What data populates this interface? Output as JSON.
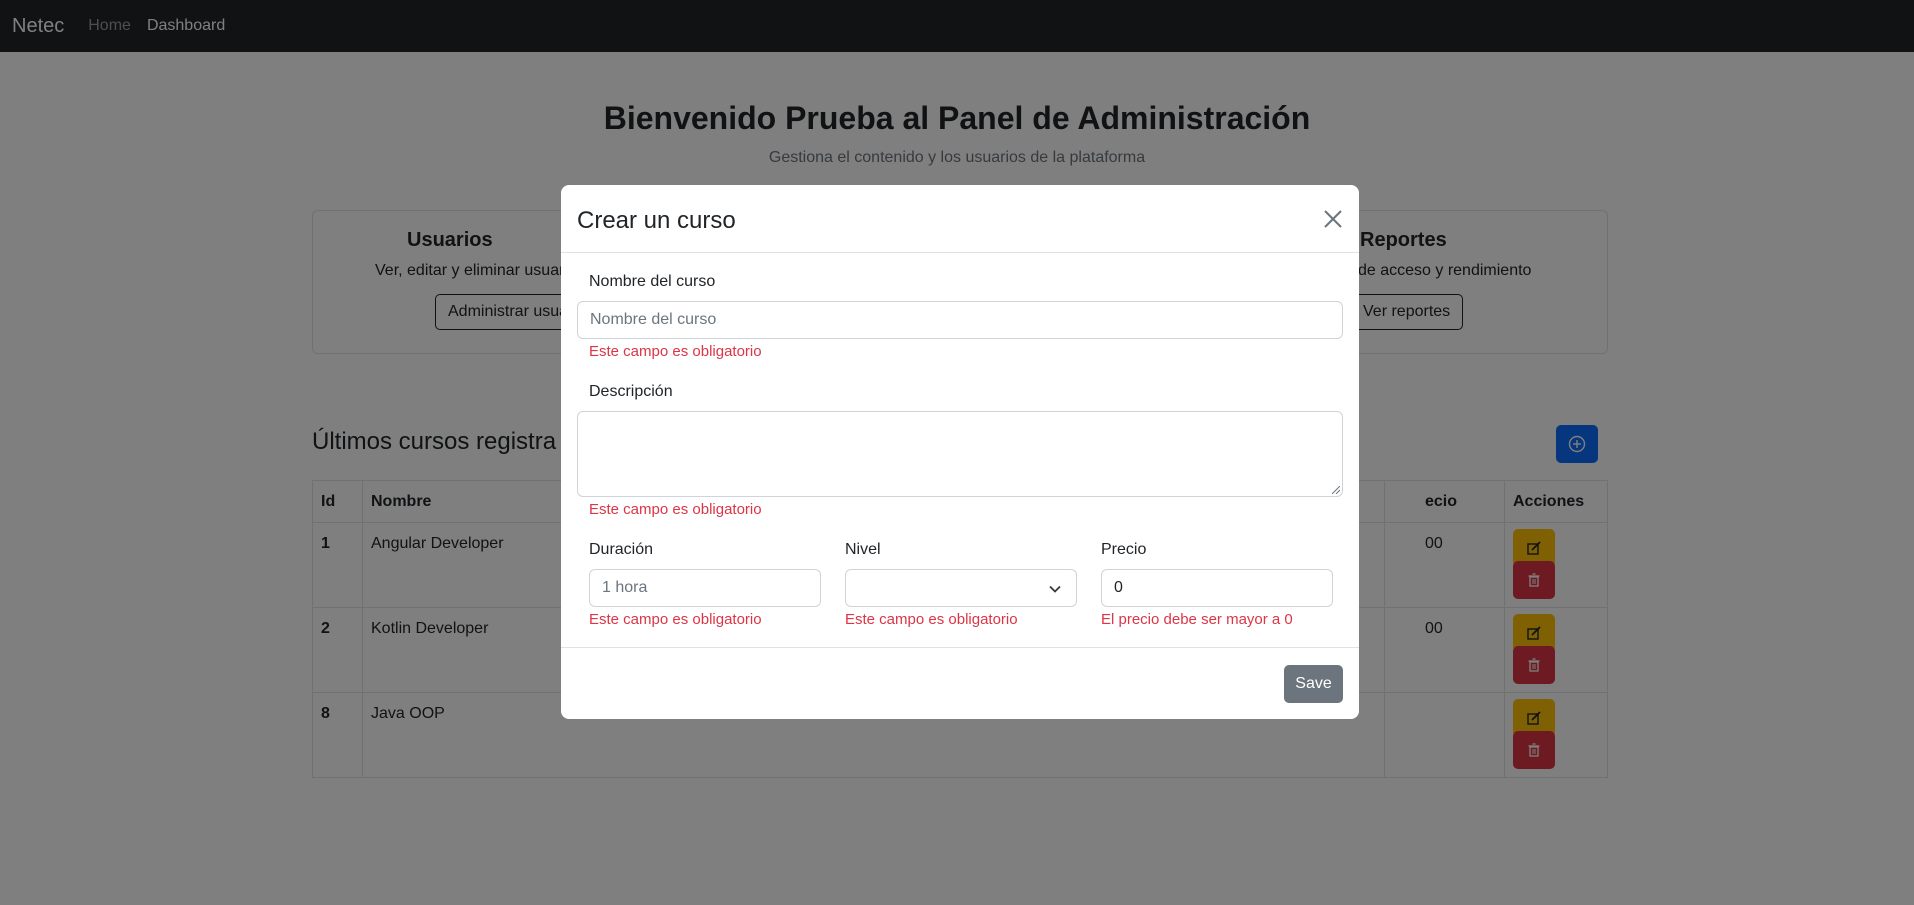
{
  "navbar": {
    "brand": "Netec",
    "links": [
      "Home",
      "Dashboard"
    ]
  },
  "page": {
    "title": "Bienvenido Prueba al Panel de Administración",
    "subtitle": "Gestiona el contenido y los usuarios de la plataforma"
  },
  "cards": [
    {
      "title": "Usuarios",
      "text": "Ver, editar y eliminar usuar",
      "button": "Administrar usua"
    },
    {
      "title": "Reportes",
      "text": "de acceso y rendimiento",
      "button": "Ver reportes"
    }
  ],
  "courses": {
    "title": "Últimos cursos registra",
    "headers": [
      "Id",
      "Nombre",
      "ecio",
      "Acciones"
    ],
    "rows": [
      {
        "id": "1",
        "name": "Angular Developer",
        "price": "00"
      },
      {
        "id": "2",
        "name": "Kotlin Developer",
        "price": "00"
      },
      {
        "id": "8",
        "name": "Java OOP",
        "price": ""
      }
    ]
  },
  "modal": {
    "title": "Crear un curso",
    "nombre": {
      "label": "Nombre del curso",
      "placeholder": "Nombre del curso",
      "value": "",
      "error": "Este campo es obligatorio"
    },
    "descripcion": {
      "label": "Descripción",
      "value": "",
      "error": "Este campo es obligatorio"
    },
    "duracion": {
      "label": "Duración",
      "placeholder": "1 hora",
      "value": "",
      "error": "Este campo es obligatorio"
    },
    "nivel": {
      "label": "Nivel",
      "value": "",
      "error": "Este campo es obligatorio"
    },
    "precio": {
      "label": "Precio",
      "value": "0",
      "error": "El precio debe ser mayor a 0"
    },
    "save_label": "Save"
  },
  "colors": {
    "primary": "#0d6efd",
    "warning": "#ffc107",
    "danger": "#dc3545",
    "secondary": "#6c757d",
    "dark": "#212529"
  },
  "icons": {
    "add": "plus-circle-icon",
    "edit": "pencil-square-icon",
    "delete": "trash-icon",
    "close": "close-icon",
    "select": "chevron-down-icon"
  }
}
